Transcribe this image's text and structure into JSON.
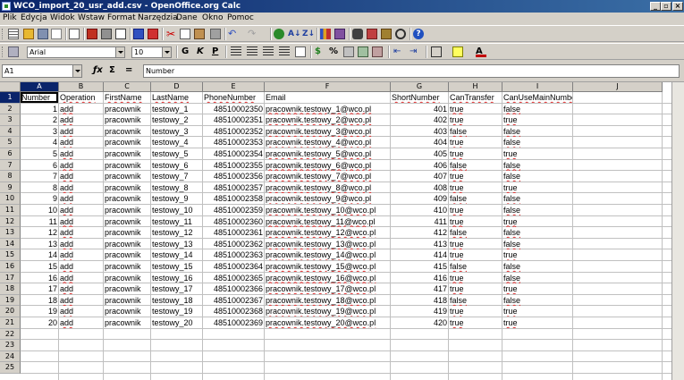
{
  "window": {
    "title": "WCO_import_20_usr_add.csv - OpenOffice.org Calc"
  },
  "menu": {
    "items": [
      "Plik",
      "Edycja",
      "Widok",
      "Wstaw",
      "Format",
      "Narzędzia",
      "Dane",
      "Okno",
      "Pomoc"
    ]
  },
  "format_toolbar": {
    "font_name": "Arial",
    "font_size": "10",
    "bold": "G",
    "italic": "K",
    "underline": "P"
  },
  "formula_bar": {
    "cell_ref": "A1",
    "content": "Number"
  },
  "sheet": {
    "columns": [
      "A",
      "B",
      "C",
      "D",
      "E",
      "F",
      "G",
      "H",
      "I",
      "J"
    ],
    "selected_column": "A",
    "selected_row": 1,
    "header": [
      "Number",
      "Operation",
      "FirstName",
      "LastName",
      "PhoneNumber",
      "Email",
      "ShortNumber",
      "CanTransfer",
      "CanUseMainNumber"
    ],
    "rows": [
      [
        "1",
        "add",
        "pracownik",
        "testowy_1",
        "48510002350",
        "pracownik.testowy_1@wco.pl",
        "401",
        "true",
        "false"
      ],
      [
        "2",
        "add",
        "pracownik",
        "testowy_2",
        "48510002351",
        "pracownik.testowy_2@wco.pl",
        "402",
        "true",
        "true"
      ],
      [
        "3",
        "add",
        "pracownik",
        "testowy_3",
        "48510002352",
        "pracownik.testowy_3@wco.pl",
        "403",
        "false",
        "false"
      ],
      [
        "4",
        "add",
        "pracownik",
        "testowy_4",
        "48510002353",
        "pracownik.testowy_4@wco.pl",
        "404",
        "true",
        "false"
      ],
      [
        "5",
        "add",
        "pracownik",
        "testowy_5",
        "48510002354",
        "pracownik.testowy_5@wco.pl",
        "405",
        "true",
        "true"
      ],
      [
        "6",
        "add",
        "pracownik",
        "testowy_6",
        "48510002355",
        "pracownik.testowy_6@wco.pl",
        "406",
        "false",
        "false"
      ],
      [
        "7",
        "add",
        "pracownik",
        "testowy_7",
        "48510002356",
        "pracownik.testowy_7@wco.pl",
        "407",
        "true",
        "false"
      ],
      [
        "8",
        "add",
        "pracownik",
        "testowy_8",
        "48510002357",
        "pracownik.testowy_8@wco.pl",
        "408",
        "true",
        "true"
      ],
      [
        "9",
        "add",
        "pracownik",
        "testowy_9",
        "48510002358",
        "pracownik.testowy_9@wco.pl",
        "409",
        "false",
        "false"
      ],
      [
        "10",
        "add",
        "pracownik",
        "testowy_10",
        "48510002359",
        "pracownik.testowy_10@wco.pl",
        "410",
        "true",
        "false"
      ],
      [
        "11",
        "add",
        "pracownik",
        "testowy_11",
        "48510002360",
        "pracownik.testowy_11@wco.pl",
        "411",
        "true",
        "true"
      ],
      [
        "12",
        "add",
        "pracownik",
        "testowy_12",
        "48510002361",
        "pracownik.testowy_12@wco.pl",
        "412",
        "false",
        "false"
      ],
      [
        "13",
        "add",
        "pracownik",
        "testowy_13",
        "48510002362",
        "pracownik.testowy_13@wco.pl",
        "413",
        "true",
        "false"
      ],
      [
        "14",
        "add",
        "pracownik",
        "testowy_14",
        "48510002363",
        "pracownik.testowy_14@wco.pl",
        "414",
        "true",
        "true"
      ],
      [
        "15",
        "add",
        "pracownik",
        "testowy_15",
        "48510002364",
        "pracownik.testowy_15@wco.pl",
        "415",
        "false",
        "false"
      ],
      [
        "16",
        "add",
        "pracownik",
        "testowy_16",
        "48510002365",
        "pracownik.testowy_16@wco.pl",
        "416",
        "true",
        "false"
      ],
      [
        "17",
        "add",
        "pracownik",
        "testowy_17",
        "48510002366",
        "pracownik.testowy_17@wco.pl",
        "417",
        "true",
        "true"
      ],
      [
        "18",
        "add",
        "pracownik",
        "testowy_18",
        "48510002367",
        "pracownik.testowy_18@wco.pl",
        "418",
        "false",
        "false"
      ],
      [
        "19",
        "add",
        "pracownik",
        "testowy_19",
        "48510002368",
        "pracownik.testowy_19@wco.pl",
        "419",
        "true",
        "true"
      ],
      [
        "20",
        "add",
        "pracownik",
        "testowy_20",
        "48510002369",
        "pracownik.testowy_20@wco.pl",
        "420",
        "true",
        "true"
      ]
    ],
    "row_numbers": [
      "1",
      "2",
      "3",
      "4",
      "5",
      "6",
      "7",
      "8",
      "9",
      "10",
      "11",
      "12",
      "13",
      "14",
      "15",
      "16",
      "17",
      "18",
      "19",
      "20",
      "21",
      "22",
      "23",
      "24",
      "25"
    ]
  },
  "colors": {
    "title_bar": "#0a246a",
    "selection": "#0a246a",
    "spell_underline": "#e03030"
  }
}
